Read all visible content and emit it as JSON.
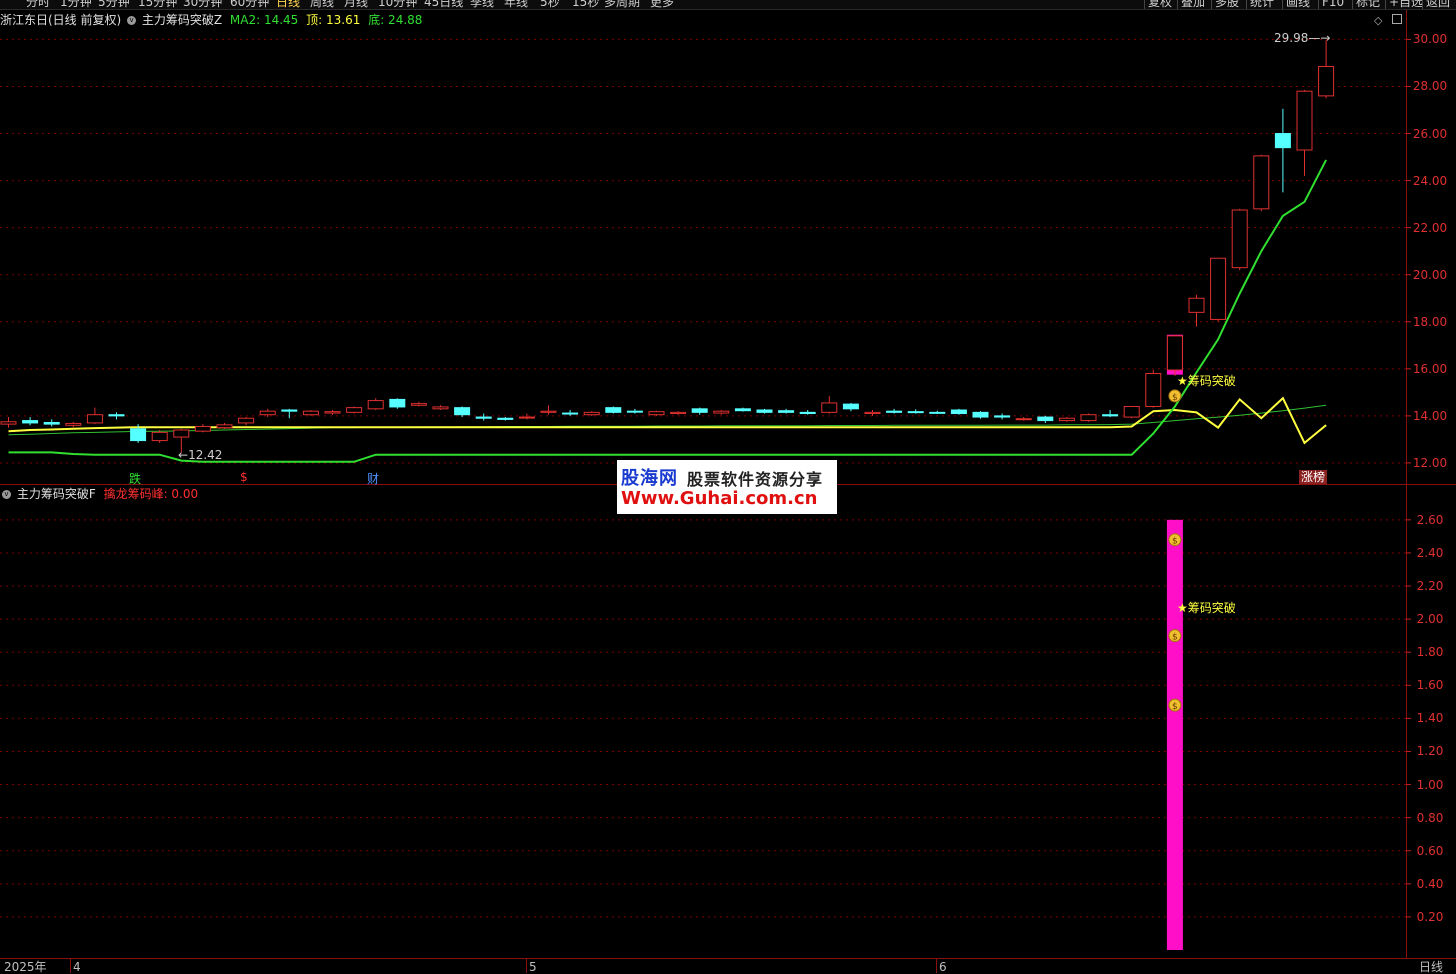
{
  "toolbar": {
    "periods": [
      "分时",
      "1分钟",
      "5分钟",
      "15分钟",
      "30分钟",
      "60分钟",
      "日线",
      "周线",
      "月线",
      "10分钟",
      "45日线",
      "季线",
      "年线",
      "5秒",
      "15秒",
      "多周期",
      "更多"
    ],
    "active": "日线",
    "right_buttons": [
      "复权",
      "叠加",
      "多股",
      "统计",
      "画线",
      "F10",
      "标记",
      "+自选",
      "返回"
    ]
  },
  "main_chart": {
    "stock_title": "浙江东日(日线 前复权)",
    "indicator_name": "主力筹码突破Z",
    "ma2_label": "MA2: 14.45",
    "top_label": "顶: 13.61",
    "bottom_label": "底: 24.88",
    "high_marker": "29.98",
    "low_marker": "12.42",
    "signal_text": "筹码突破",
    "flag_die": "跌",
    "flag_s": "$",
    "flag_cai": "财",
    "flag_zhangbang": "涨榜",
    "y_ticks": [
      "30.00",
      "28.00",
      "26.00",
      "24.00",
      "22.00",
      "20.00",
      "18.00",
      "16.00",
      "14.00",
      "12.00"
    ]
  },
  "sub_chart": {
    "indicator_name": "主力筹码突破F",
    "value_label": "擒龙筹码峰: 0.00",
    "signal_text": "筹码突破",
    "y_ticks": [
      "2.60",
      "2.40",
      "2.20",
      "2.00",
      "1.80",
      "1.60",
      "1.40",
      "1.20",
      "1.00",
      "0.80",
      "0.60",
      "0.40",
      "0.20"
    ]
  },
  "bottom_axis": {
    "year": "2025年",
    "months": [
      "4",
      "5",
      "6"
    ],
    "period": "日线"
  },
  "watermark": {
    "brand": "股海网",
    "slogan": "股票软件资源分享",
    "url": "Www.Guhai.com.cn"
  },
  "colors": {
    "up": "#e03030",
    "down": "#55ffff",
    "green_line": "#30e030",
    "yellow_line": "#ffff40",
    "magenta": "#ff10c8",
    "grid": "#7a0000"
  },
  "chart_data": {
    "type": "candlestick",
    "candles": [
      {
        "o": 13.65,
        "h": 13.95,
        "l": 13.5,
        "c": 13.75
      },
      {
        "o": 13.8,
        "h": 13.95,
        "l": 13.6,
        "c": 13.7
      },
      {
        "o": 13.72,
        "h": 13.85,
        "l": 13.55,
        "c": 13.65
      },
      {
        "o": 13.6,
        "h": 13.75,
        "l": 13.52,
        "c": 13.68
      },
      {
        "o": 13.7,
        "h": 14.35,
        "l": 13.65,
        "c": 14.05
      },
      {
        "o": 14.05,
        "h": 14.15,
        "l": 13.85,
        "c": 14.0
      },
      {
        "o": 13.45,
        "h": 13.65,
        "l": 12.85,
        "c": 12.95
      },
      {
        "o": 12.95,
        "h": 13.4,
        "l": 12.85,
        "c": 13.3
      },
      {
        "o": 13.1,
        "h": 13.45,
        "l": 12.42,
        "c": 13.4
      },
      {
        "o": 13.35,
        "h": 13.65,
        "l": 13.3,
        "c": 13.55
      },
      {
        "o": 13.5,
        "h": 13.7,
        "l": 13.45,
        "c": 13.62
      },
      {
        "o": 13.7,
        "h": 13.95,
        "l": 13.6,
        "c": 13.9
      },
      {
        "o": 14.05,
        "h": 14.3,
        "l": 13.95,
        "c": 14.2
      },
      {
        "o": 14.25,
        "h": 14.3,
        "l": 13.9,
        "c": 14.2
      },
      {
        "o": 14.05,
        "h": 14.25,
        "l": 14.0,
        "c": 14.2
      },
      {
        "o": 14.12,
        "h": 14.25,
        "l": 14.05,
        "c": 14.18
      },
      {
        "o": 14.15,
        "h": 14.4,
        "l": 14.1,
        "c": 14.35
      },
      {
        "o": 14.3,
        "h": 14.75,
        "l": 14.25,
        "c": 14.65
      },
      {
        "o": 14.7,
        "h": 14.75,
        "l": 14.3,
        "c": 14.38
      },
      {
        "o": 14.45,
        "h": 14.6,
        "l": 14.4,
        "c": 14.52
      },
      {
        "o": 14.3,
        "h": 14.45,
        "l": 14.25,
        "c": 14.38
      },
      {
        "o": 14.35,
        "h": 14.4,
        "l": 13.95,
        "c": 14.05
      },
      {
        "o": 13.95,
        "h": 14.1,
        "l": 13.8,
        "c": 13.9
      },
      {
        "o": 13.9,
        "h": 13.95,
        "l": 13.8,
        "c": 13.85
      },
      {
        "o": 13.95,
        "h": 14.1,
        "l": 13.85,
        "c": 13.95
      },
      {
        "o": 14.15,
        "h": 14.45,
        "l": 14.05,
        "c": 14.2
      },
      {
        "o": 14.12,
        "h": 14.25,
        "l": 14.0,
        "c": 14.1
      },
      {
        "o": 14.05,
        "h": 14.2,
        "l": 14.0,
        "c": 14.15
      },
      {
        "o": 14.35,
        "h": 14.4,
        "l": 14.1,
        "c": 14.15
      },
      {
        "o": 14.2,
        "h": 14.3,
        "l": 14.1,
        "c": 14.18
      },
      {
        "o": 14.05,
        "h": 14.22,
        "l": 14.0,
        "c": 14.18
      },
      {
        "o": 14.1,
        "h": 14.2,
        "l": 14.05,
        "c": 14.15
      },
      {
        "o": 14.3,
        "h": 14.35,
        "l": 14.05,
        "c": 14.15
      },
      {
        "o": 14.12,
        "h": 14.25,
        "l": 14.05,
        "c": 14.2
      },
      {
        "o": 14.3,
        "h": 14.35,
        "l": 14.18,
        "c": 14.22
      },
      {
        "o": 14.25,
        "h": 14.3,
        "l": 14.1,
        "c": 14.15
      },
      {
        "o": 14.22,
        "h": 14.3,
        "l": 14.1,
        "c": 14.15
      },
      {
        "o": 14.15,
        "h": 14.25,
        "l": 14.05,
        "c": 14.1
      },
      {
        "o": 14.15,
        "h": 14.85,
        "l": 14.1,
        "c": 14.55
      },
      {
        "o": 14.5,
        "h": 14.55,
        "l": 14.2,
        "c": 14.3
      },
      {
        "o": 14.1,
        "h": 14.25,
        "l": 14.0,
        "c": 14.15
      },
      {
        "o": 14.2,
        "h": 14.3,
        "l": 14.1,
        "c": 14.15
      },
      {
        "o": 14.18,
        "h": 14.28,
        "l": 14.1,
        "c": 14.15
      },
      {
        "o": 14.15,
        "h": 14.22,
        "l": 14.08,
        "c": 14.12
      },
      {
        "o": 14.25,
        "h": 14.3,
        "l": 14.05,
        "c": 14.1
      },
      {
        "o": 14.15,
        "h": 14.2,
        "l": 13.88,
        "c": 13.95
      },
      {
        "o": 14.0,
        "h": 14.1,
        "l": 13.85,
        "c": 13.95
      },
      {
        "o": 13.85,
        "h": 13.95,
        "l": 13.8,
        "c": 13.88
      },
      {
        "o": 13.95,
        "h": 14.0,
        "l": 13.7,
        "c": 13.8
      },
      {
        "o": 13.8,
        "h": 13.95,
        "l": 13.75,
        "c": 13.9
      },
      {
        "o": 13.8,
        "h": 14.1,
        "l": 13.75,
        "c": 14.05
      },
      {
        "o": 14.05,
        "h": 14.25,
        "l": 13.95,
        "c": 14.0
      },
      {
        "o": 13.95,
        "h": 14.4,
        "l": 13.9,
        "c": 14.4
      },
      {
        "o": 14.4,
        "h": 15.95,
        "l": 14.35,
        "c": 15.8
      },
      {
        "o": 15.95,
        "h": 17.45,
        "l": 15.7,
        "c": 17.4
      },
      {
        "o": 18.4,
        "h": 19.15,
        "l": 17.8,
        "c": 19.0
      },
      {
        "o": 18.1,
        "h": 20.7,
        "l": 18.0,
        "c": 20.7
      },
      {
        "o": 20.3,
        "h": 22.8,
        "l": 20.2,
        "c": 22.75
      },
      {
        "o": 22.8,
        "h": 25.1,
        "l": 22.7,
        "c": 25.05
      },
      {
        "o": 26.0,
        "h": 27.05,
        "l": 23.5,
        "c": 25.4
      },
      {
        "o": 25.3,
        "h": 27.85,
        "l": 24.2,
        "c": 27.8
      },
      {
        "o": 27.6,
        "h": 29.98,
        "l": 27.5,
        "c": 28.85
      }
    ],
    "green_line": [
      12.45,
      12.45,
      12.45,
      12.38,
      12.35,
      12.35,
      12.35,
      12.35,
      12.1,
      12.05,
      12.05,
      12.05,
      12.05,
      12.05,
      12.05,
      12.05,
      12.05,
      12.35,
      12.35,
      12.35,
      12.35,
      12.35,
      12.35,
      12.35,
      12.35,
      12.35,
      12.35,
      12.35,
      12.35,
      12.35,
      12.35,
      12.35,
      12.35,
      12.35,
      12.35,
      12.35,
      12.35,
      12.35,
      12.35,
      12.35,
      12.35,
      12.35,
      12.35,
      12.35,
      12.35,
      12.35,
      12.35,
      12.35,
      12.35,
      12.35,
      12.35,
      12.35,
      12.35,
      13.25,
      14.4,
      15.85,
      17.25,
      19.2,
      21.0,
      22.5,
      23.1,
      24.88
    ],
    "yellow_line": [
      13.35,
      13.4,
      13.42,
      13.45,
      13.48,
      13.5,
      13.52,
      13.52,
      13.52,
      13.52,
      13.52,
      13.52,
      13.52,
      13.52,
      13.52,
      13.52,
      13.52,
      13.52,
      13.52,
      13.52,
      13.52,
      13.52,
      13.52,
      13.52,
      13.52,
      13.52,
      13.52,
      13.52,
      13.52,
      13.52,
      13.52,
      13.52,
      13.52,
      13.52,
      13.52,
      13.52,
      13.52,
      13.52,
      13.52,
      13.52,
      13.52,
      13.52,
      13.52,
      13.52,
      13.52,
      13.52,
      13.52,
      13.52,
      13.52,
      13.52,
      13.52,
      13.52,
      13.55,
      14.2,
      14.25,
      14.15,
      13.5,
      14.7,
      13.9,
      14.75,
      12.85,
      13.61
    ],
    "ma_line": [
      13.2,
      13.22,
      13.25,
      13.28,
      13.3,
      13.32,
      13.34,
      13.35,
      13.36,
      13.38,
      13.4,
      13.42,
      13.44,
      13.46,
      13.48,
      13.5,
      13.5,
      13.52,
      13.52,
      13.53,
      13.53,
      13.54,
      13.54,
      13.55,
      13.55,
      13.55,
      13.56,
      13.56,
      13.56,
      13.56,
      13.57,
      13.57,
      13.57,
      13.58,
      13.58,
      13.58,
      13.58,
      13.58,
      13.59,
      13.59,
      13.59,
      13.6,
      13.6,
      13.6,
      13.6,
      13.6,
      13.61,
      13.61,
      13.61,
      13.62,
      13.62,
      13.63,
      13.65,
      13.72,
      13.8,
      13.88,
      13.95,
      14.03,
      14.12,
      14.22,
      14.33,
      14.45
    ],
    "main_ylim": [
      11.7,
      30.4
    ],
    "sub_bar_index": 54,
    "sub_bar_value": 2.6,
    "sub_icons": [
      2.48,
      1.9,
      1.48
    ],
    "sub_signal_value": 2.0,
    "sub_ylim": [
      0,
      2.72
    ]
  }
}
